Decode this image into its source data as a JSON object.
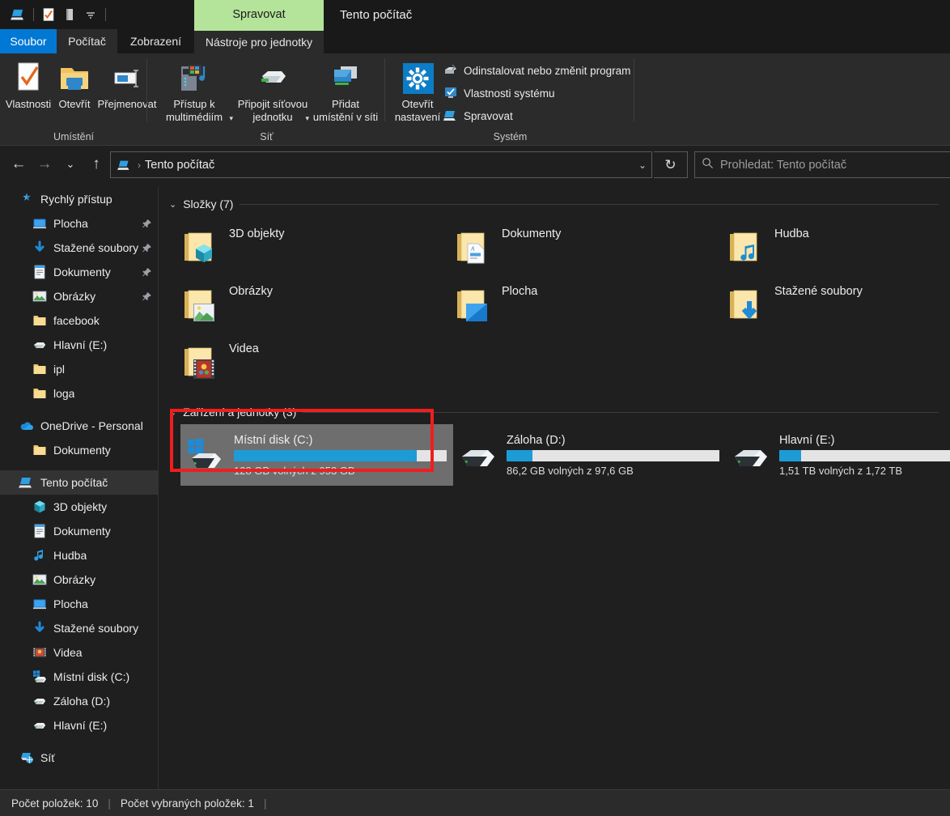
{
  "window": {
    "title": "Tento počítač",
    "contextual_tab": "Spravovat",
    "quick_access_icons": [
      "this-pc-icon",
      "properties-icon",
      "new-folder-icon",
      "customize-dropdown-icon"
    ]
  },
  "tabs": [
    {
      "label": "Soubor",
      "state": "file-menu"
    },
    {
      "label": "Počítač",
      "state": "active"
    },
    {
      "label": "Zobrazení",
      "state": "normal"
    },
    {
      "label": "Nástroje pro jednotky",
      "state": "contextual"
    }
  ],
  "ribbon": {
    "groups": [
      {
        "label": "Umístění",
        "big_buttons": [
          {
            "label": "Vlastnosti",
            "icon": "properties-checkmark-icon"
          },
          {
            "label": "Otevřít",
            "icon": "open-folder-icon"
          },
          {
            "label": "Přejmenovat",
            "icon": "rename-icon"
          }
        ]
      },
      {
        "label": "Síť",
        "big_buttons": [
          {
            "label": "Přístup k\nmultimédiím",
            "icon": "media-server-icon",
            "has_dropdown": true
          },
          {
            "label": "Připojit síťovou\njednotku",
            "icon": "map-network-drive-icon",
            "has_dropdown": true
          },
          {
            "label": "Přidat\numístění v síti",
            "icon": "add-network-location-icon",
            "has_dropdown": false
          }
        ]
      },
      {
        "label": "Systém",
        "big_buttons": [
          {
            "label": "Otevřít\nnastavení",
            "icon": "settings-gear-icon"
          }
        ],
        "small_buttons": [
          {
            "label": "Odinstalovat nebo změnit program",
            "icon": "uninstall-program-icon"
          },
          {
            "label": "Vlastnosti systému",
            "icon": "system-properties-icon"
          },
          {
            "label": "Spravovat",
            "icon": "manage-computer-icon"
          }
        ]
      }
    ]
  },
  "navbar": {
    "back": "←",
    "forward": "→",
    "recent": "⌄",
    "up": "↑",
    "breadcrumb_icon": "this-pc-icon",
    "breadcrumb": "Tento počítač",
    "dropdown": "⌄",
    "refresh": "↻"
  },
  "search": {
    "icon": "search-icon",
    "placeholder": "Prohledat: Tento počítač"
  },
  "sidebar": {
    "items": [
      {
        "label": "Rychlý přístup",
        "icon": "pin-star-icon",
        "indent": 0,
        "pinned": false,
        "selected": false
      },
      {
        "label": "Plocha",
        "icon": "desktop-icon",
        "indent": 1,
        "pinned": true,
        "selected": false
      },
      {
        "label": "Stažené soubory",
        "icon": "downloads-icon",
        "indent": 1,
        "pinned": true,
        "selected": false
      },
      {
        "label": "Dokumenty",
        "icon": "documents-icon",
        "indent": 1,
        "pinned": true,
        "selected": false
      },
      {
        "label": "Obrázky",
        "icon": "pictures-icon",
        "indent": 1,
        "pinned": true,
        "selected": false
      },
      {
        "label": "facebook",
        "icon": "folder-icon",
        "indent": 1,
        "pinned": false,
        "selected": false
      },
      {
        "label": "Hlavní (E:)",
        "icon": "drive-icon",
        "indent": 1,
        "pinned": false,
        "selected": false
      },
      {
        "label": "ipl",
        "icon": "folder-icon",
        "indent": 1,
        "pinned": false,
        "selected": false
      },
      {
        "label": "loga",
        "icon": "folder-icon",
        "indent": 1,
        "pinned": false,
        "selected": false
      },
      {
        "label": "SPACER",
        "icon": "spacer",
        "indent": 0,
        "pinned": false,
        "selected": false
      },
      {
        "label": "OneDrive - Personal",
        "icon": "onedrive-icon",
        "indent": 0,
        "pinned": false,
        "selected": false
      },
      {
        "label": "Dokumenty",
        "icon": "folder-icon",
        "indent": 1,
        "pinned": false,
        "selected": false
      },
      {
        "label": "SPACER",
        "icon": "spacer",
        "indent": 0,
        "pinned": false,
        "selected": false
      },
      {
        "label": "Tento počítač",
        "icon": "this-pc-icon",
        "indent": 0,
        "pinned": false,
        "selected": true
      },
      {
        "label": "3D objekty",
        "icon": "3d-objects-icon",
        "indent": 1,
        "pinned": false,
        "selected": false
      },
      {
        "label": "Dokumenty",
        "icon": "documents-icon",
        "indent": 1,
        "pinned": false,
        "selected": false
      },
      {
        "label": "Hudba",
        "icon": "music-note-icon",
        "indent": 1,
        "pinned": false,
        "selected": false
      },
      {
        "label": "Obrázky",
        "icon": "pictures-icon",
        "indent": 1,
        "pinned": false,
        "selected": false
      },
      {
        "label": "Plocha",
        "icon": "desktop-icon",
        "indent": 1,
        "pinned": false,
        "selected": false
      },
      {
        "label": "Stažené soubory",
        "icon": "downloads-icon",
        "indent": 1,
        "pinned": false,
        "selected": false
      },
      {
        "label": "Videa",
        "icon": "videos-icon",
        "indent": 1,
        "pinned": false,
        "selected": false
      },
      {
        "label": "Místní disk (C:)",
        "icon": "windows-drive-icon",
        "indent": 1,
        "pinned": false,
        "selected": false
      },
      {
        "label": "Záloha (D:)",
        "icon": "drive-icon",
        "indent": 1,
        "pinned": false,
        "selected": false
      },
      {
        "label": "Hlavní (E:)",
        "icon": "drive-icon",
        "indent": 1,
        "pinned": false,
        "selected": false
      },
      {
        "label": "SPACER",
        "icon": "spacer",
        "indent": 0,
        "pinned": false,
        "selected": false
      },
      {
        "label": "Síť",
        "icon": "network-icon",
        "indent": 0,
        "pinned": false,
        "selected": false
      }
    ]
  },
  "content": {
    "folders_group": {
      "title": "Složky (7)",
      "chevron": "⌄",
      "items": [
        {
          "name": "3D objekty",
          "icon": "folder-3d-objects-icon"
        },
        {
          "name": "Dokumenty",
          "icon": "folder-documents-icon"
        },
        {
          "name": "Hudba",
          "icon": "folder-music-icon"
        },
        {
          "name": "Obrázky",
          "icon": "folder-pictures-icon"
        },
        {
          "name": "Plocha",
          "icon": "folder-desktop-icon"
        },
        {
          "name": "Stažené soubory",
          "icon": "folder-downloads-icon"
        },
        {
          "name": "Videa",
          "icon": "folder-videos-icon"
        }
      ]
    },
    "drives_group": {
      "title": "Zařízení a jednotky (3)",
      "chevron": "⌄",
      "items": [
        {
          "name": "Místní disk (C:)",
          "free_text": "128 GB volných z 953 GB",
          "used_percent": 86,
          "icon": "windows-drive-icon",
          "selected": true,
          "highlighted": true
        },
        {
          "name": "Záloha (D:)",
          "free_text": "86,2 GB volných z 97,6 GB",
          "used_percent": 12,
          "icon": "drive-icon",
          "selected": false,
          "highlighted": false
        },
        {
          "name": "Hlavní (E:)",
          "free_text": "1,51 TB volných z 1,72 TB",
          "used_percent": 12,
          "icon": "drive-icon",
          "selected": false,
          "highlighted": false
        }
      ]
    }
  },
  "statusbar": {
    "item_count": "Počet položek: 10",
    "divider1": "|",
    "selected_count": "Počet vybraných položek: 1",
    "divider2": "|"
  },
  "colors": {
    "accent_blue": "#0078d4",
    "contextual_green": "#b4e49a",
    "highlight_red": "#f11d1d",
    "bar_blue": "#1d9bd7",
    "selection_gray": "#6e6e6e",
    "window_bg": "#1f1f1f"
  }
}
